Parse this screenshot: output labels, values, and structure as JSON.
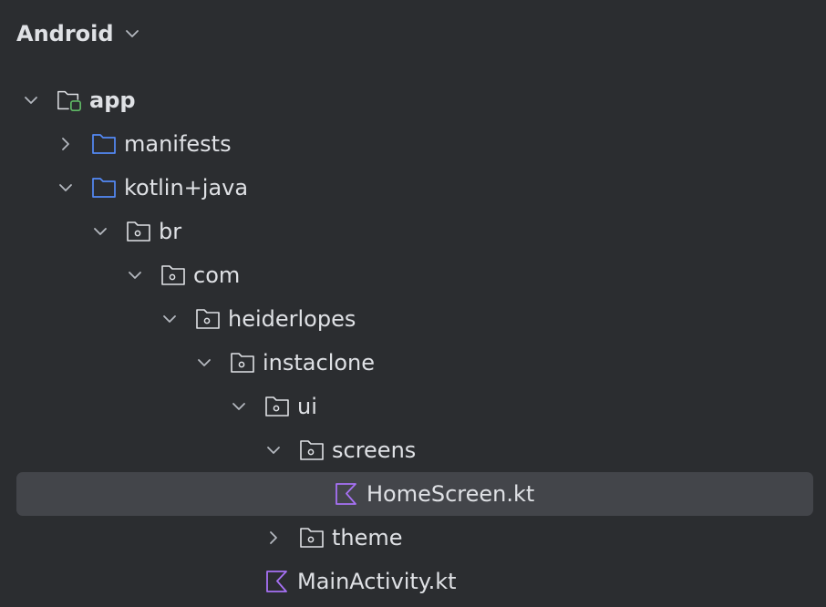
{
  "header": {
    "title": "Android",
    "chevron_icon": "chevron-down-icon"
  },
  "tree": {
    "nodes": [
      {
        "label": "app",
        "depth": 0,
        "toggle": "expanded",
        "icon": "module-folder-icon",
        "bold": true,
        "selected": false
      },
      {
        "label": "manifests",
        "depth": 1,
        "toggle": "collapsed",
        "icon": "source-folder-icon",
        "bold": false,
        "selected": false
      },
      {
        "label": "kotlin+java",
        "depth": 1,
        "toggle": "expanded",
        "icon": "source-folder-icon",
        "bold": false,
        "selected": false
      },
      {
        "label": "br",
        "depth": 2,
        "toggle": "expanded",
        "icon": "package-folder-icon",
        "bold": false,
        "selected": false
      },
      {
        "label": "com",
        "depth": 3,
        "toggle": "expanded",
        "icon": "package-folder-icon",
        "bold": false,
        "selected": false
      },
      {
        "label": "heiderlopes",
        "depth": 4,
        "toggle": "expanded",
        "icon": "package-folder-icon",
        "bold": false,
        "selected": false
      },
      {
        "label": "instaclone",
        "depth": 5,
        "toggle": "expanded",
        "icon": "package-folder-icon",
        "bold": false,
        "selected": false
      },
      {
        "label": "ui",
        "depth": 6,
        "toggle": "expanded",
        "icon": "package-folder-icon",
        "bold": false,
        "selected": false
      },
      {
        "label": "screens",
        "depth": 7,
        "toggle": "expanded",
        "icon": "package-folder-icon",
        "bold": false,
        "selected": false
      },
      {
        "label": "HomeScreen.kt",
        "depth": 8,
        "toggle": "none",
        "icon": "kotlin-file-icon",
        "bold": false,
        "selected": true
      },
      {
        "label": "theme",
        "depth": 7,
        "toggle": "collapsed",
        "icon": "package-folder-icon",
        "bold": false,
        "selected": false
      },
      {
        "label": "MainActivity.kt",
        "depth": 6,
        "toggle": "none",
        "icon": "kotlin-file-icon",
        "bold": false,
        "selected": false
      }
    ]
  },
  "colors": {
    "background": "#2b2d30",
    "selection": "#43454a",
    "text": "#dfe1e5",
    "chevron": "#b4b8bf",
    "source_folder": "#548af7",
    "module_badge": "#5fb865",
    "kotlin": "#a771f5"
  }
}
